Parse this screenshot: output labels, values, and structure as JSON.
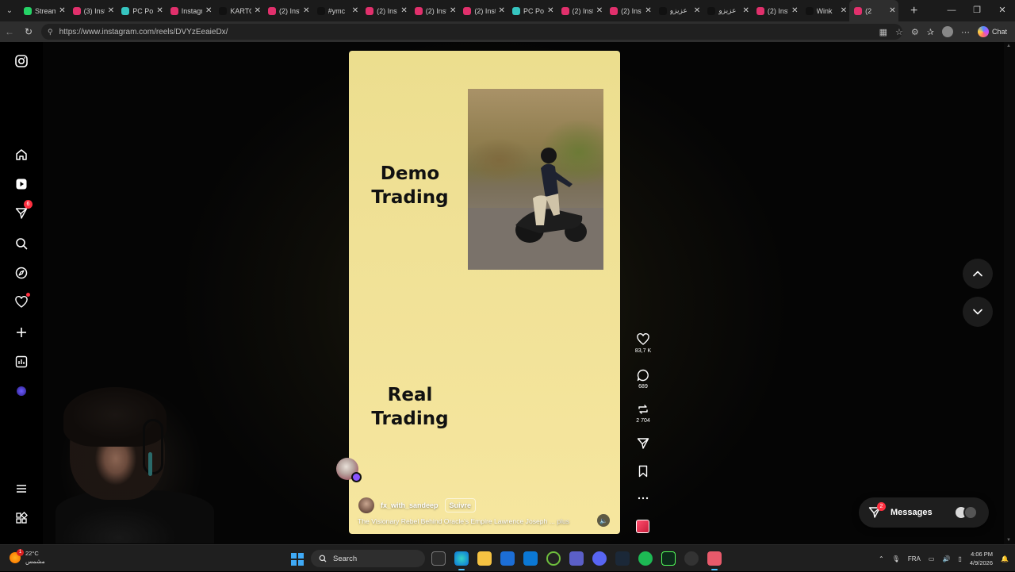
{
  "browser": {
    "tabs": [
      {
        "title": "Stream",
        "favicon": "#25d366",
        "glyph": "kick"
      },
      {
        "title": "(3) Inst",
        "favicon": "#e1306c",
        "glyph": "instagram"
      },
      {
        "title": "PC Por",
        "favicon": "#36c5c0",
        "glyph": "pcpor"
      },
      {
        "title": "Instagr",
        "favicon": "#e1306c",
        "glyph": "instagram"
      },
      {
        "title": "KARTO",
        "favicon": "#111111",
        "glyph": "tiktok"
      },
      {
        "title": "(2) Inst",
        "favicon": "#e1306c",
        "glyph": "instagram"
      },
      {
        "title": "#ymc",
        "favicon": "#111111",
        "glyph": "tiktok"
      },
      {
        "title": "(2) Inst",
        "favicon": "#e1306c",
        "glyph": "instagram"
      },
      {
        "title": "(2) Inst",
        "favicon": "#e1306c",
        "glyph": "instagram"
      },
      {
        "title": "(2) Inst",
        "favicon": "#e1306c",
        "glyph": "instagram"
      },
      {
        "title": "PC Por",
        "favicon": "#36c5c0",
        "glyph": "pcpor"
      },
      {
        "title": "(2) Inst",
        "favicon": "#e1306c",
        "glyph": "instagram"
      },
      {
        "title": "(2) Inst",
        "favicon": "#e1306c",
        "glyph": "instagram"
      },
      {
        "title": "عزيزو",
        "favicon": "#111111",
        "glyph": "tiktok"
      },
      {
        "title": "عزيزو",
        "favicon": "#111111",
        "glyph": "tiktok"
      },
      {
        "title": "(2) Inst",
        "favicon": "#e1306c",
        "glyph": "instagram"
      },
      {
        "title": "Wink",
        "favicon": "#111111",
        "glyph": "tiktok"
      },
      {
        "title": "(2",
        "favicon": "#e1306c",
        "glyph": "instagram",
        "active": true
      }
    ],
    "url": "https://www.instagram.com/reels/DVYzEeaieDx/",
    "chat_label": "Chat"
  },
  "nav": {
    "notifications_badge": "6"
  },
  "reel": {
    "heading_top_line1": "Demo",
    "heading_top_line2": "Trading",
    "heading_bottom_line1": "Real",
    "heading_bottom_line2": "Trading",
    "author": "fx_with_sandeep",
    "follow_label": "Suivre",
    "caption": "The Visionary Rebel Behind Oracle's Empire Lawrence Joseph ...",
    "more_label": "plus"
  },
  "actions": {
    "likes": "83,7 K",
    "comments": "689",
    "reposts": "2 704"
  },
  "messages": {
    "label": "Messages",
    "badge": "2"
  },
  "taskbar": {
    "weather_temp": "22°C",
    "weather_desc": "مشمس",
    "weather_badge": "1",
    "search_placeholder": "Search",
    "language": "FRA",
    "time": "4:06 PM",
    "date": "4/9/2026"
  },
  "colors": {
    "reel_bg": "#f0e196",
    "badge_red": "#ff3040"
  }
}
